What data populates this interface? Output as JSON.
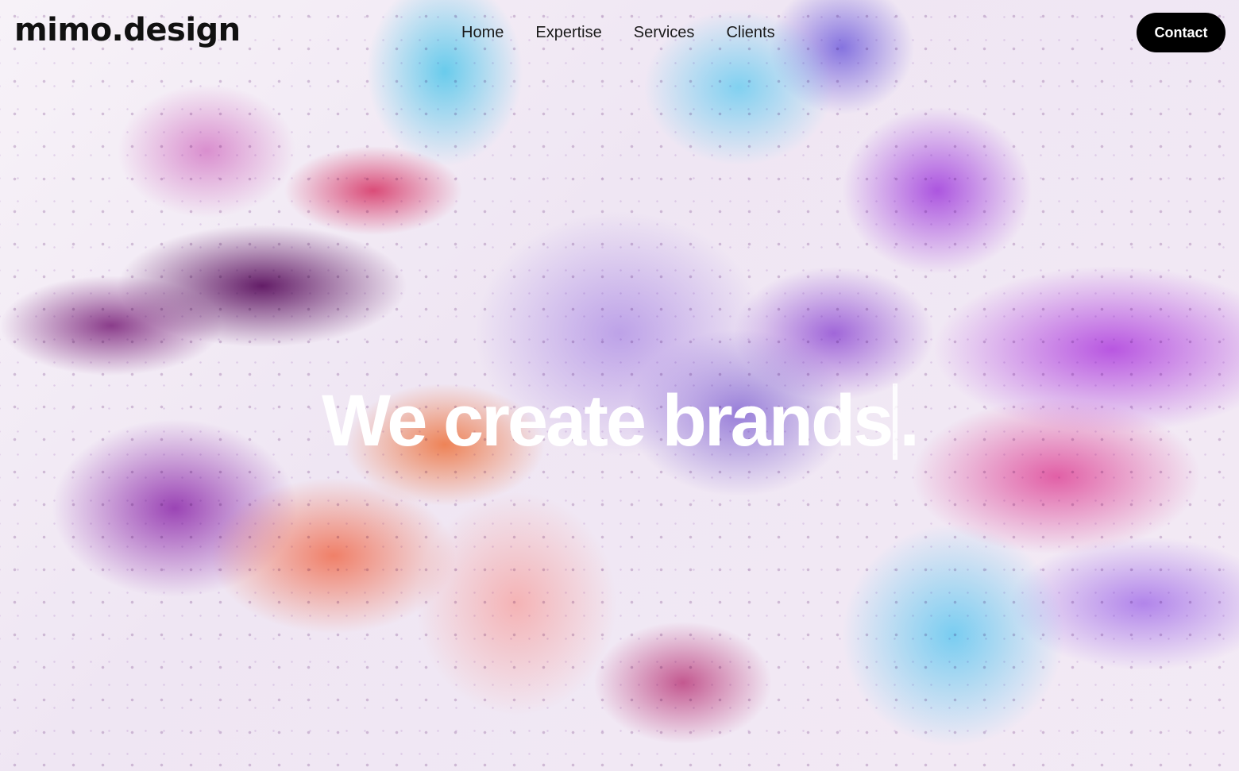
{
  "header": {
    "logo_text": "mimo.design",
    "nav": [
      {
        "label": "Home"
      },
      {
        "label": "Expertise"
      },
      {
        "label": "Services"
      },
      {
        "label": "Clients"
      }
    ],
    "contact_label": "Contact"
  },
  "hero": {
    "headline_text": "We create brands",
    "headline_suffix": ".",
    "text_color": "#ffffff",
    "background_palette": [
      "#5c1260",
      "#d63062",
      "#5ac8eb",
      "#a032dc",
      "#ee7846",
      "#f5aaaa"
    ]
  },
  "colors": {
    "button_bg": "#000000",
    "button_text": "#ffffff",
    "nav_text": "#1a1a1a"
  }
}
